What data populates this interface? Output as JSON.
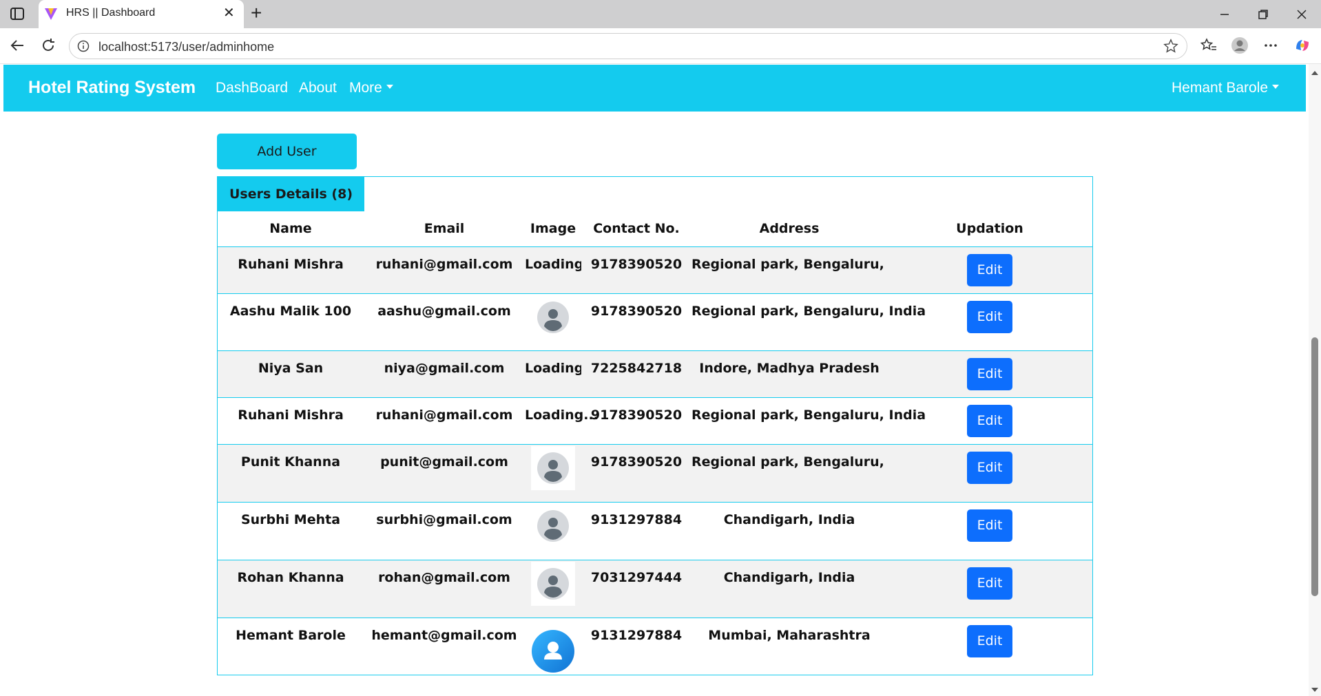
{
  "browser": {
    "tab_title": "HRS || Dashboard",
    "url": "localhost:5173/user/adminhome"
  },
  "navbar": {
    "brand": "Hotel Rating System",
    "links": [
      "DashBoard",
      "About",
      "More"
    ],
    "user": "Hemant Barole"
  },
  "add_user_label": "Add User",
  "card": {
    "title": "Users Details (8)"
  },
  "table": {
    "headers": [
      "Name",
      "Email",
      "Image",
      "Contact No.",
      "Address",
      "Updation"
    ],
    "rows": [
      {
        "name": "Ruhani Mishra",
        "email": "ruhani@gmail.com",
        "image": "Loading...",
        "contact": "9178390520",
        "address": "Regional park, Bengaluru, India",
        "action": "Edit"
      },
      {
        "name": "Aashu Malik 100",
        "email": "aashu@gmail.com",
        "image": "grey-avatar-icon",
        "contact": "9178390520",
        "address": "Regional park, Bengaluru, India",
        "action": "Edit"
      },
      {
        "name": "Niya San",
        "email": "niya@gmail.com",
        "image": "Loading...",
        "contact": "7225842718",
        "address": "Indore, Madhya Pradesh",
        "action": "Edit"
      },
      {
        "name": "Ruhani Mishra",
        "email": "ruhani@gmail.com",
        "image": "Loading...",
        "contact": "9178390520",
        "address": "Regional park, Bengaluru, India",
        "action": "Edit"
      },
      {
        "name": "Punit Khanna",
        "email": "punit@gmail.com",
        "image": "grey-avatar-icon",
        "contact": "9178390520",
        "address": "Regional park, Bengaluru, India",
        "action": "Edit"
      },
      {
        "name": "Surbhi Mehta",
        "email": "surbhi@gmail.com",
        "image": "grey-avatar-icon",
        "contact": "9131297884",
        "address": "Chandigarh, India",
        "action": "Edit"
      },
      {
        "name": "Rohan Khanna",
        "email": "rohan@gmail.com",
        "image": "grey-avatar-icon",
        "contact": "7031297444",
        "address": "Chandigarh, India",
        "action": "Edit"
      },
      {
        "name": "Hemant Barole",
        "email": "hemant@gmail.com",
        "image": "blue-avatar-icon",
        "contact": "9131297884",
        "address": "Mumbai, Maharashtra",
        "action": "Edit"
      }
    ]
  },
  "colors": {
    "navbar": "#14cbee",
    "edit_button": "#0d6efd",
    "row_shade": "#f2f2f2"
  }
}
